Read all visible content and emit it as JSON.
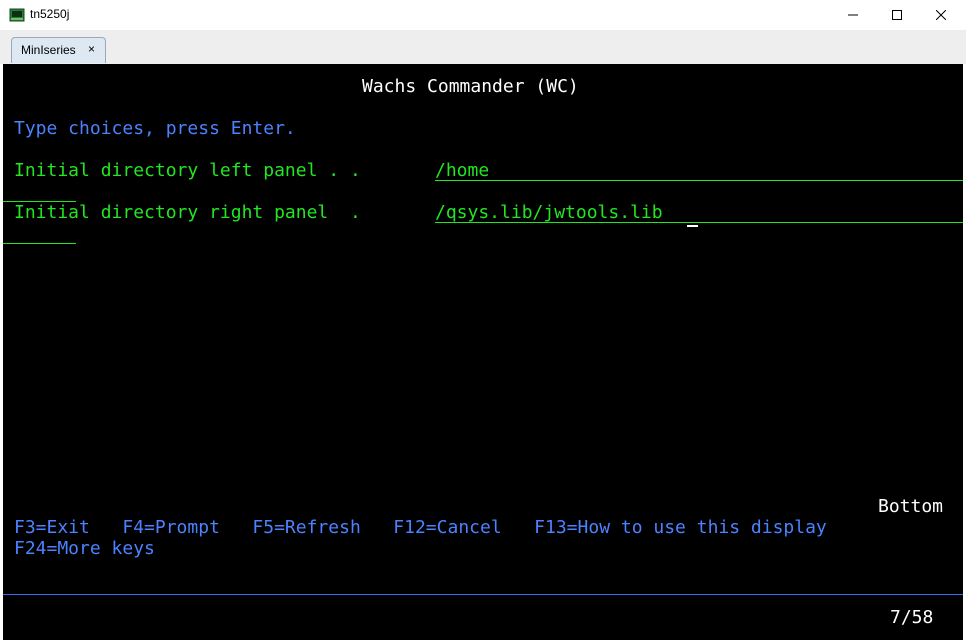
{
  "window": {
    "title": "tn5250j",
    "icon": "tn5250j-app-icon",
    "minimize_label": "—",
    "maximize_label": "☐",
    "close_label": "✕"
  },
  "tabs": [
    {
      "label": "MinIseries",
      "close_label": "×"
    }
  ],
  "screen": {
    "title": "Wachs Commander (WC)",
    "instruction": "Type choices, press Enter.",
    "fields": [
      {
        "label": "Initial directory left panel . .",
        "value": "/home"
      },
      {
        "label": "Initial directory right panel  .",
        "value": "/qsys.lib/jwtools.lib"
      }
    ],
    "more_indicator": "Bottom",
    "function_keys_line1": "F3=Exit   F4=Prompt   F5=Refresh   F12=Cancel   F13=How to use this display",
    "function_keys_line2": "F24=More keys",
    "cursor_position": "7/58"
  },
  "colors": {
    "terminal_bg": "#000000",
    "title_text": "#ffffff",
    "instruction_text": "#4b82ff",
    "field_text": "#22e622",
    "function_key_text": "#4b82ff"
  }
}
